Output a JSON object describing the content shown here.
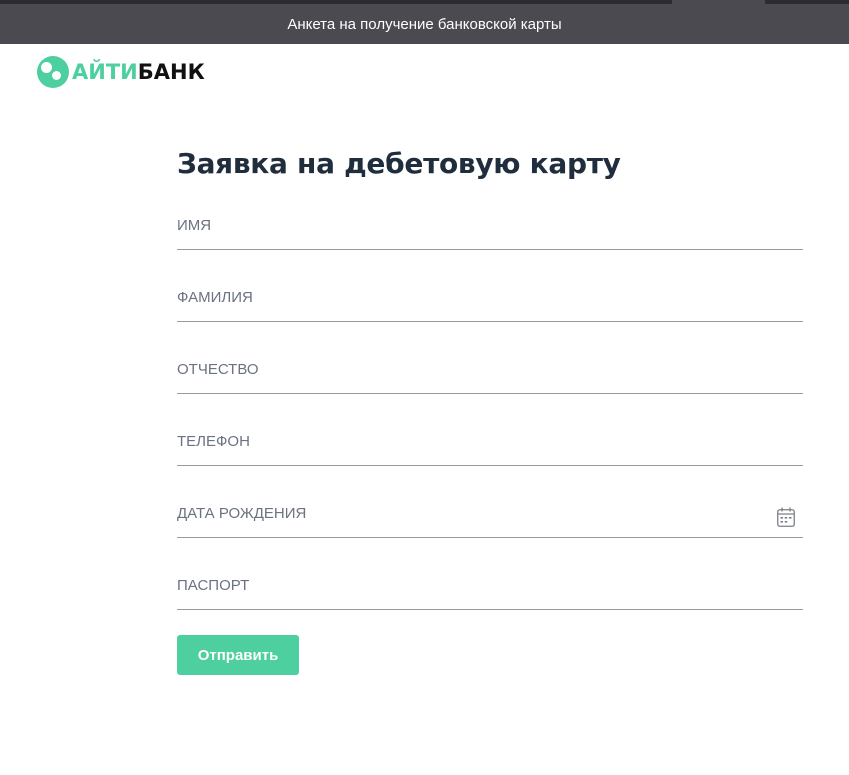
{
  "window": {
    "title": "Анкета на получение банковской карты"
  },
  "logo": {
    "text_green": "АЙТИ",
    "text_dark": "БАНК",
    "icon": "logo-circles-icon"
  },
  "colors": {
    "accent": "#4dcf9f",
    "titlebar": "#4a4a50",
    "heading": "#1f2d3d",
    "underline": "#9a9a9a"
  },
  "form": {
    "title": "Заявка на дебетовую карту",
    "fields": {
      "first_name": {
        "placeholder": "имя",
        "value": ""
      },
      "last_name": {
        "placeholder": "фамилия",
        "value": ""
      },
      "patronymic": {
        "placeholder": "отчество",
        "value": ""
      },
      "phone": {
        "placeholder": "телефон",
        "value": ""
      },
      "birth_date": {
        "placeholder": "дата рождения",
        "value": "",
        "icon": "calendar-icon"
      },
      "passport": {
        "placeholder": "паспорт",
        "value": ""
      }
    },
    "submit_label": "Отправить"
  }
}
